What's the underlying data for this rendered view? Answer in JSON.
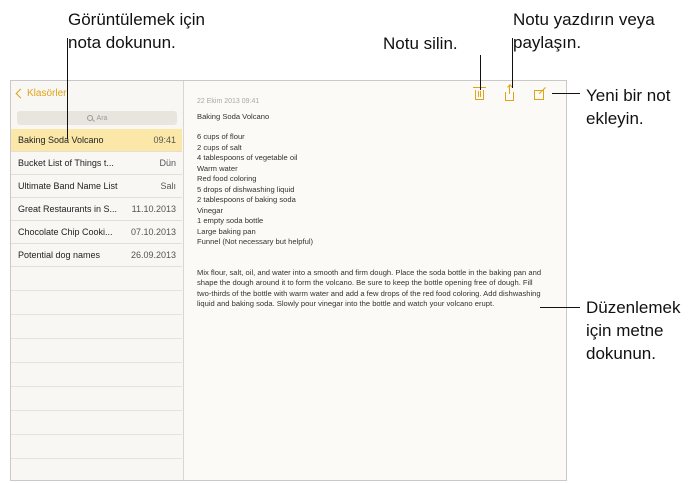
{
  "callouts": {
    "tap_note": "Görüntülemek için\nnota dokunun.",
    "delete_note": "Notu silin.",
    "print_share": "Notu yazdırın veya\npaylaşın.",
    "new_note": "Yeni bir not\nekleyin.",
    "edit_text": "Düzenlemek\niçin metne\ndokunun."
  },
  "sidebar": {
    "back_label": "Klasörler",
    "search_placeholder": "Ara",
    "notes": [
      {
        "title": "Baking Soda Volcano",
        "date": "09:41",
        "selected": true
      },
      {
        "title": "Bucket List of Things t...",
        "date": "Dün"
      },
      {
        "title": "Ultimate Band Name List",
        "date": "Salı"
      },
      {
        "title": "Great Restaurants in S...",
        "date": "11.10.2013"
      },
      {
        "title": "Chocolate Chip Cooki...",
        "date": "07.10.2013"
      },
      {
        "title": "Potential dog names",
        "date": "26.09.2013"
      }
    ]
  },
  "toolbar": {
    "delete_icon": "trash-icon",
    "share_icon": "share-icon",
    "compose_icon": "compose-icon",
    "accent_color": "#e0a316"
  },
  "note": {
    "timestamp": "22 Ekim 2013 09:41",
    "title": "Baking Soda Volcano",
    "ingredients": [
      "6 cups of flour",
      "2 cups of salt",
      "4 tablespoons of vegetable oil",
      "Warm water",
      "Red food coloring",
      "5 drops of dishwashing liquid",
      "2 tablespoons of baking soda",
      "Vinegar",
      "1 empty soda bottle",
      "Large baking pan",
      "Funnel (Not necessary but helpful)"
    ],
    "instructions": "Mix flour, salt, oil, and water into a smooth and firm dough.  Place the soda bottle in the baking pan and shape the dough around it to form the volcano.  Be sure to keep the bottle opening free of dough.  Fill two-thirds of the bottle with warm water and add a few drops of the red food coloring. Add dishwashing liquid and baking soda. Slowly pour vinegar into the bottle and watch your volcano erupt."
  }
}
